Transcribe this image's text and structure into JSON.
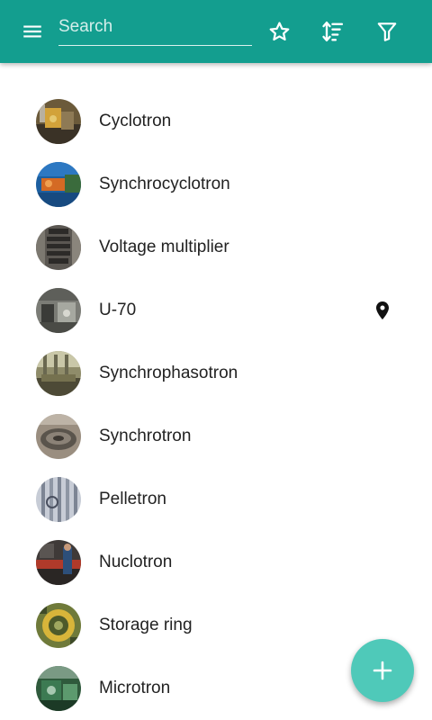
{
  "toolbar": {
    "menu_icon": "menu-icon",
    "search_placeholder": "Search",
    "favorites_icon": "star-outline-icon",
    "sort_icon": "sort-icon",
    "filter_icon": "filter-icon",
    "color": "#139e8f"
  },
  "list": {
    "items": [
      {
        "label": "Cyclotron",
        "has_location": false
      },
      {
        "label": "Synchrocyclotron",
        "has_location": false
      },
      {
        "label": "Voltage multiplier",
        "has_location": false
      },
      {
        "label": "U-70",
        "has_location": true
      },
      {
        "label": "Synchrophasotron",
        "has_location": false
      },
      {
        "label": "Synchrotron",
        "has_location": false
      },
      {
        "label": "Pelletron",
        "has_location": false
      },
      {
        "label": "Nuclotron",
        "has_location": false
      },
      {
        "label": "Storage ring",
        "has_location": false
      },
      {
        "label": "Microtron",
        "has_location": false
      }
    ]
  },
  "fab": {
    "icon": "plus-icon",
    "color": "#4fc9b9"
  }
}
